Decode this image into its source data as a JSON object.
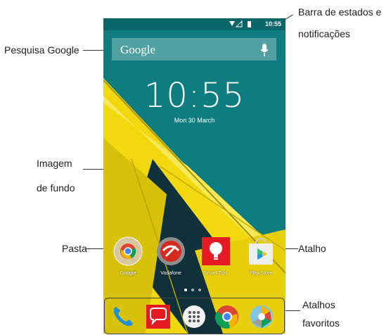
{
  "callouts": {
    "status_bar_line1": "Barra de estados e",
    "status_bar_line2": "notificações",
    "google_search": "Pesquisa Google",
    "wallpaper_line1": "Imagem",
    "wallpaper_line2": "de  fundo",
    "folder": "Pasta",
    "shortcut": "Atalho",
    "favorites_line1": "Atalhos",
    "favorites_line2": "favoritos"
  },
  "phone": {
    "status_time": "10:55",
    "search_logo": "Google",
    "clock_time": "10:55",
    "clock_date": "Mon 30 March",
    "apps": [
      {
        "label": "Google",
        "icon": "google-folder-icon"
      },
      {
        "label": "Vodafone",
        "icon": "vodafone-icon"
      },
      {
        "label": "Smart Tips",
        "icon": "smart-tips-icon"
      },
      {
        "label": "Play Store",
        "icon": "play-store-icon"
      }
    ],
    "dock": [
      {
        "icon": "phone-icon"
      },
      {
        "icon": "messages-icon"
      },
      {
        "icon": "app-drawer-icon"
      },
      {
        "icon": "chrome-icon"
      },
      {
        "icon": "camera-icon"
      }
    ]
  },
  "colors": {
    "teal": "#0f7d80",
    "yellow": "#f2d80f",
    "dark": "#10303a",
    "smart_tips_red": "#e51b24",
    "vodafone_red": "#d52b1e"
  }
}
